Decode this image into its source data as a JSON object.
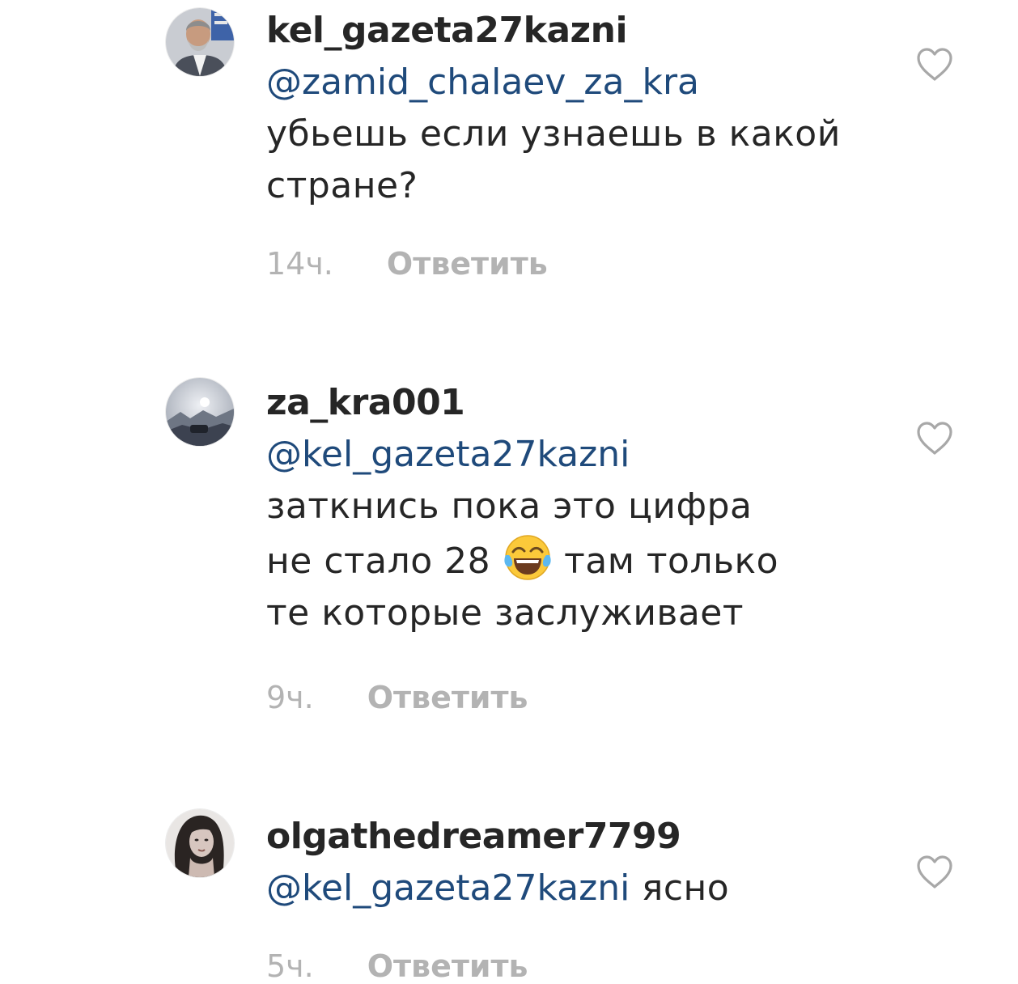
{
  "comments": [
    {
      "username": "kel_gazeta27kazni",
      "mention": "@zamid_chalaev_za_kra",
      "text": "убьешь если узнаешь в какой стране?",
      "time": "14ч.",
      "reply_label": "Ответить"
    },
    {
      "username": "za_kra001",
      "mention": "@kel_gazeta27kazni",
      "text_line1": "заткнись пока это цифра",
      "text_line2_before": "не стало 28",
      "emoji": "face-with-tears-of-joy",
      "text_line2_after": "там только",
      "text_line3": "те которые заслуживает",
      "time": "9ч.",
      "reply_label": "Ответить"
    },
    {
      "username": "olgathedreamer7799",
      "mention": "@kel_gazeta27kazni",
      "text": " ясно",
      "time": "5ч.",
      "reply_label": "Ответить"
    }
  ],
  "icons": {
    "like": "heart-outline-icon",
    "emoji": "face-with-tears-of-joy"
  },
  "colors": {
    "text": "#262626",
    "mention": "#1f4a7b",
    "meta": "#b3b3b3",
    "background": "#ffffff"
  }
}
